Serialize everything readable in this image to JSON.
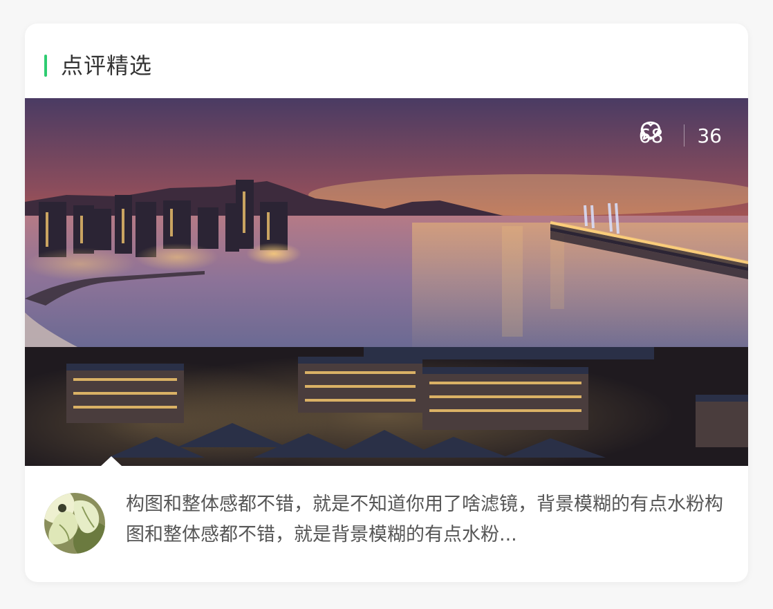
{
  "section": {
    "title": "点评精选",
    "accent_color": "#2ecc71"
  },
  "post": {
    "photo_icon": "city-bay-night-photo",
    "comments_count": "68",
    "likes_count": "36",
    "comment_icon": "speech-bubble-icon",
    "like_icon": "heart-icon"
  },
  "review": {
    "avatar_icon": "leaf-avatar",
    "text": "构图和整体感都不错，就是不知道你用了啥滤镜，背景模糊的有点水粉构图和整体感都不错，就是背景模糊的有点水粉..."
  }
}
